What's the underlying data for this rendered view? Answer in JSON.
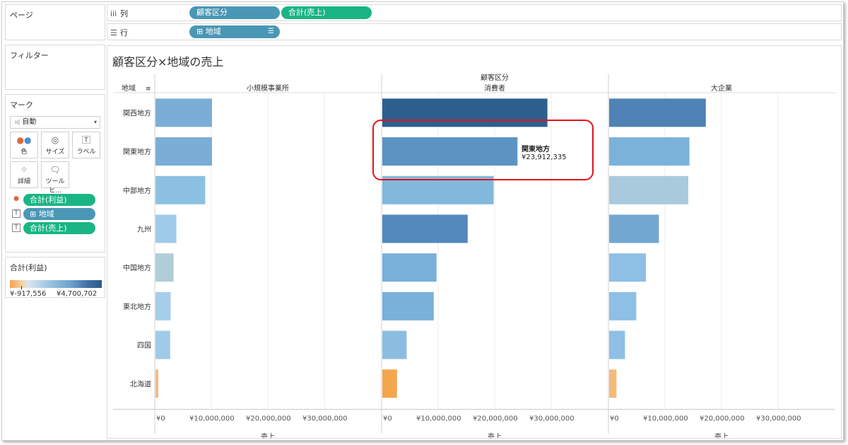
{
  "cards": {
    "pages": "ページ",
    "filters": "フィルター",
    "marks": {
      "title": "マーク",
      "mark_type": "自動",
      "buttons": {
        "color": "色",
        "size": "サイズ",
        "label": "ラベル",
        "detail": "詳細",
        "tooltip": "ツールヒ..."
      },
      "fields": [
        {
          "label": "合計(利益)",
          "kind": "color",
          "color": "#1ab583"
        },
        {
          "label": "⊞ 地域",
          "kind": "text",
          "color": "#4a97b5"
        },
        {
          "label": "合計(売上)",
          "kind": "text",
          "color": "#1ab583"
        }
      ]
    },
    "legend": {
      "title": "合計(利益)",
      "min": "¥-917,556",
      "max": "¥4,700,702"
    }
  },
  "shelves": {
    "columns": {
      "label": "列",
      "pills": [
        "顧客区分",
        "合計(売上)"
      ]
    },
    "rows": {
      "label": "行",
      "pills": [
        "⊞ 地域"
      ]
    }
  },
  "colors": {
    "dimension_pill": "#4a97b5",
    "measure_pill": "#1ab583",
    "tooltip_outline": "#e8101a"
  },
  "tooltip": {
    "region": "関東地方",
    "value": "¥23,912,335"
  },
  "chart_data": {
    "type": "bar",
    "title": "顧客区分×地域の売上",
    "column_header": "顧客区分",
    "row_header": "地域",
    "xlabel": "売上",
    "xlim": [
      0,
      40000000
    ],
    "x_ticks": [
      0,
      10000000,
      20000000,
      30000000
    ],
    "x_tick_labels": [
      "¥0",
      "¥10,000,000",
      "¥20,000,000",
      "¥30,000,000"
    ],
    "categories": [
      "関西地方",
      "関東地方",
      "中部地方",
      "九州",
      "中国地方",
      "東北地方",
      "四国",
      "北海道"
    ],
    "grid": true,
    "color_by": "合計(利益)",
    "panels": [
      {
        "name": "小規模事業所",
        "values": [
          10000000,
          10000000,
          8800000,
          3700000,
          3200000,
          2700000,
          2600000,
          500000
        ],
        "colors": [
          "#7aaed6",
          "#7aaed6",
          "#8cc0e2",
          "#a0cbe8",
          "#b1cdd9",
          "#a6cee9",
          "#a0cbe8",
          "#f4bb80"
        ]
      },
      {
        "name": "消費者",
        "values": [
          29200000,
          23912335,
          19700000,
          15100000,
          9600000,
          9100000,
          4300000,
          2600000
        ],
        "colors": [
          "#2d5f8e",
          "#5b94c3",
          "#82b8dc",
          "#5389bd",
          "#79b1da",
          "#79b1da",
          "#8cbde1",
          "#f4a64d"
        ]
      },
      {
        "name": "大企業",
        "values": [
          17100000,
          14200000,
          14000000,
          8800000,
          6500000,
          4800000,
          2800000,
          1300000
        ],
        "colors": [
          "#4f83b5",
          "#7bb2da",
          "#a9cadd",
          "#72a7d1",
          "#8ebfe4",
          "#8ebfe4",
          "#8ebfe4",
          "#f4ba7c"
        ]
      }
    ]
  }
}
